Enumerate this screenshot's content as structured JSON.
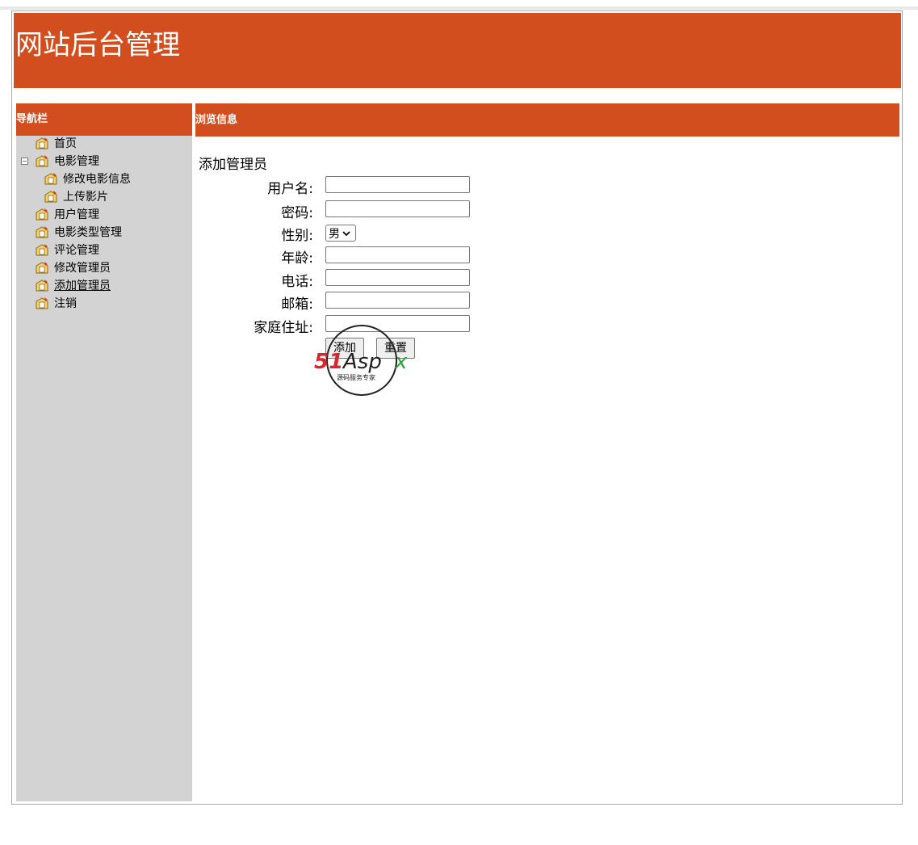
{
  "header": {
    "title": "网站后台管理"
  },
  "nav": {
    "heading": "导航栏",
    "items": [
      {
        "label": "首页",
        "level": 0
      },
      {
        "label": "电影管理",
        "level": 0,
        "expanded": true
      },
      {
        "label": "修改电影信息",
        "level": 1
      },
      {
        "label": "上传影片",
        "level": 1
      },
      {
        "label": "用户管理",
        "level": 0
      },
      {
        "label": "电影类型管理",
        "level": 0
      },
      {
        "label": "评论管理",
        "level": 0
      },
      {
        "label": "修改管理员",
        "level": 0
      },
      {
        "label": "添加管理员",
        "level": 0,
        "active": true
      },
      {
        "label": "注销",
        "level": 0
      }
    ]
  },
  "main": {
    "heading": "浏览信息",
    "form": {
      "title": "添加管理员",
      "labels": {
        "username": "用户名:",
        "password": "密码:",
        "gender": "性别:",
        "age": "年龄:",
        "phone": "电话:",
        "email": "邮箱:",
        "address": "家庭住址:"
      },
      "gender_value": "男",
      "add_button": "添加",
      "reset_button": "重置"
    }
  },
  "watermark": {
    "brand": "51Aspx",
    "tagline": "源码服务专家"
  },
  "colors": {
    "accent": "#d24e1e",
    "sidebar": "#d3d3d3"
  }
}
